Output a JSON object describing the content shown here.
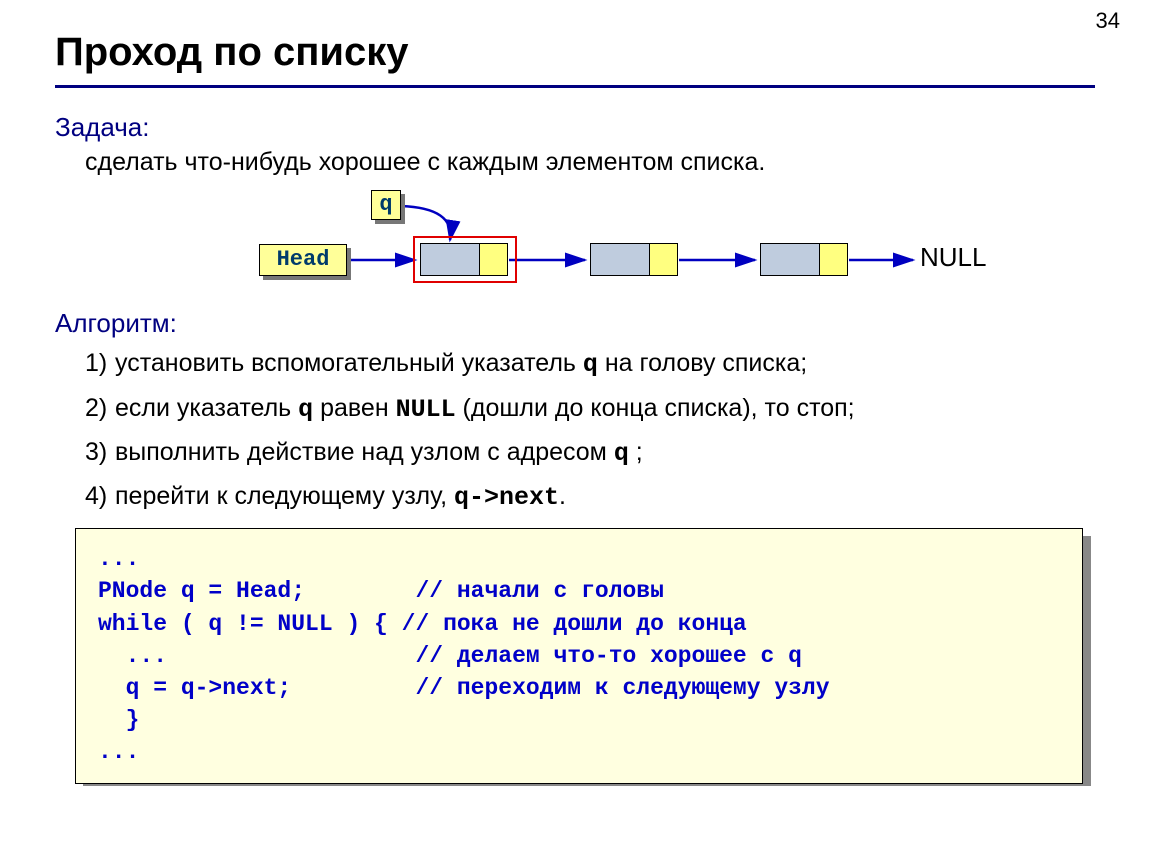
{
  "page_number": "34",
  "title": "Проход по списку",
  "task": {
    "label": "Задача:",
    "text": "сделать что-нибудь хорошее с каждым элементом списка."
  },
  "diagram": {
    "q": "q",
    "head": "Head",
    "null": "NULL"
  },
  "algorithm": {
    "label": "Алгоритм:",
    "steps": [
      {
        "n": "1)",
        "pre": "установить вспомогательный указатель ",
        "code": "q",
        "post": " на голову списка;"
      },
      {
        "n": "2)",
        "pre": "если указатель ",
        "code": "q",
        "mid": " равен ",
        "code2": "NULL",
        "post": " (дошли до конца списка), то стоп;"
      },
      {
        "n": "3)",
        "pre": "выполнить действие над узлом с адресом ",
        "code": "q",
        "post": " ;"
      },
      {
        "n": "4)",
        "pre": "перейти к следующему узлу, ",
        "code": "q->next",
        "post": "."
      }
    ]
  },
  "code": {
    "l1": "...",
    "l2a": "PNode q = Head;",
    "l2c": "// начали с головы",
    "l3a": "while ( q != NULL ) {",
    "l3c": "// пока не дошли до конца",
    "l4a": "  ...",
    "l4c": "// делаем что-то хорошее с q",
    "l5a": "  q = q->next;",
    "l5c": "// переходим к следующему узлу",
    "l6": "  }",
    "l7": "..."
  }
}
